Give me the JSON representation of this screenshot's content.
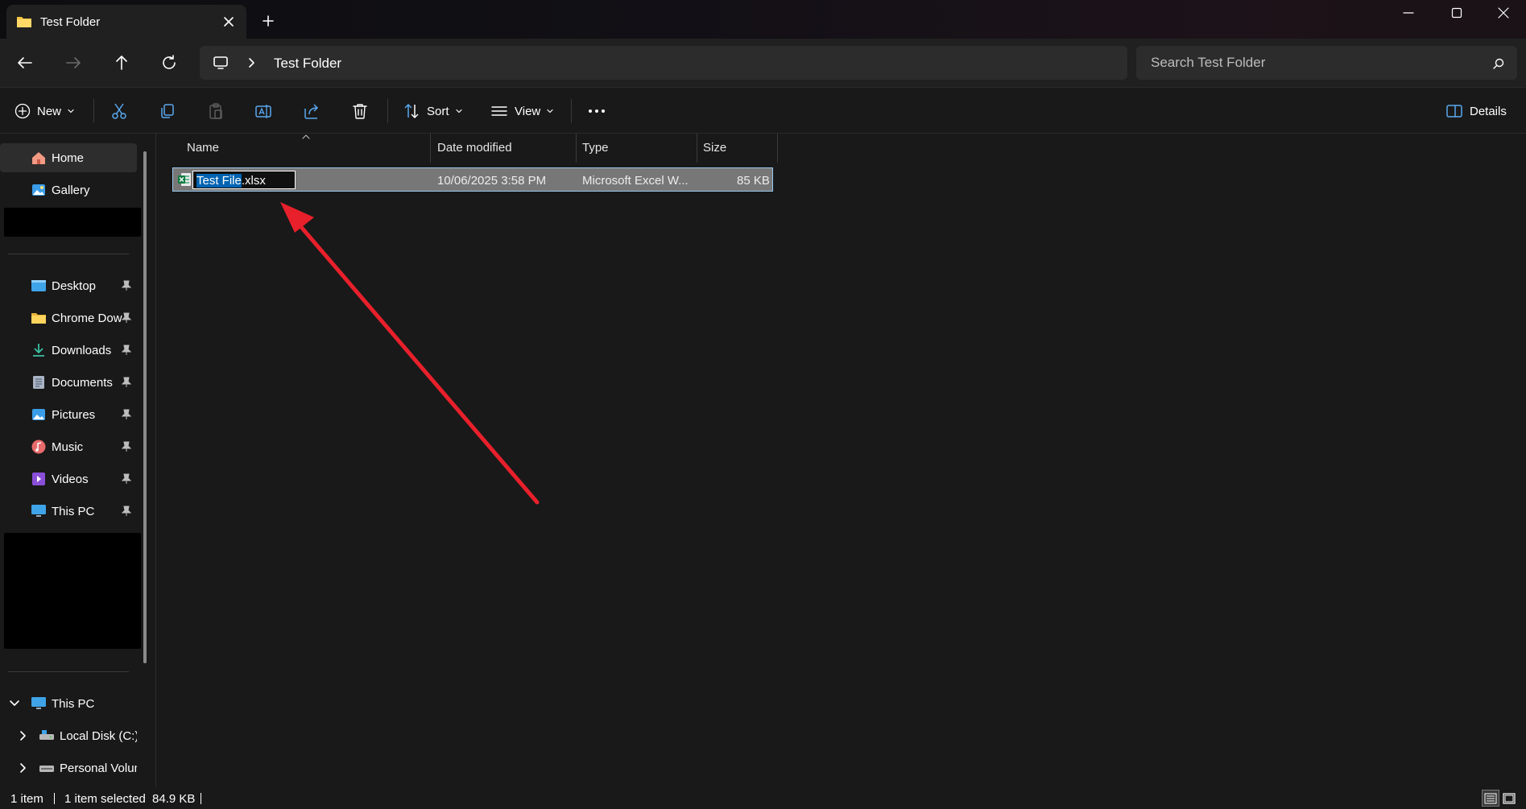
{
  "window": {
    "tab_title": "Test Folder",
    "icons": {
      "tab": "folder-icon",
      "close": "close-icon",
      "new_tab": "plus-icon",
      "minimize": "minimize-icon",
      "maximize": "maximize-icon",
      "window_close": "window-close-icon"
    }
  },
  "navigation": {
    "breadcrumb": [
      "Test Folder"
    ],
    "search_placeholder": "Search Test Folder"
  },
  "toolbar": {
    "new_label": "New",
    "sort_label": "Sort",
    "view_label": "View",
    "details_label": "Details"
  },
  "sidebar": {
    "home": "Home",
    "gallery": "Gallery",
    "quick_access": [
      {
        "label": "Desktop",
        "icon": "desktop-icon"
      },
      {
        "label": "Chrome Downloads",
        "icon": "folder-icon"
      },
      {
        "label": "Downloads",
        "icon": "downloads-icon"
      },
      {
        "label": "Documents",
        "icon": "documents-icon"
      },
      {
        "label": "Pictures",
        "icon": "pictures-icon"
      },
      {
        "label": "Music",
        "icon": "music-icon"
      },
      {
        "label": "Videos",
        "icon": "videos-icon"
      },
      {
        "label": "This PC",
        "icon": "computer-icon"
      }
    ],
    "tree": {
      "this_pc": "This PC",
      "local_disk": "Local Disk (C:)",
      "personal_volume": "Personal Volume"
    }
  },
  "file_list": {
    "columns": {
      "name": "Name",
      "date": "Date modified",
      "type": "Type",
      "size": "Size"
    },
    "rows": [
      {
        "name_selected": "Test File",
        "name_ext": ".xlsx",
        "date": "10/06/2025 3:58 PM",
        "type": "Microsoft Excel W...",
        "size": "85 KB",
        "icon": "excel-file-icon"
      }
    ]
  },
  "status": {
    "count": "1 item",
    "selected": "1 item selected",
    "size": "84.9 KB"
  },
  "colors": {
    "background": "#191919",
    "selection": "#777777",
    "text_highlight": "#0063b1",
    "annotation": "#e8202b"
  }
}
